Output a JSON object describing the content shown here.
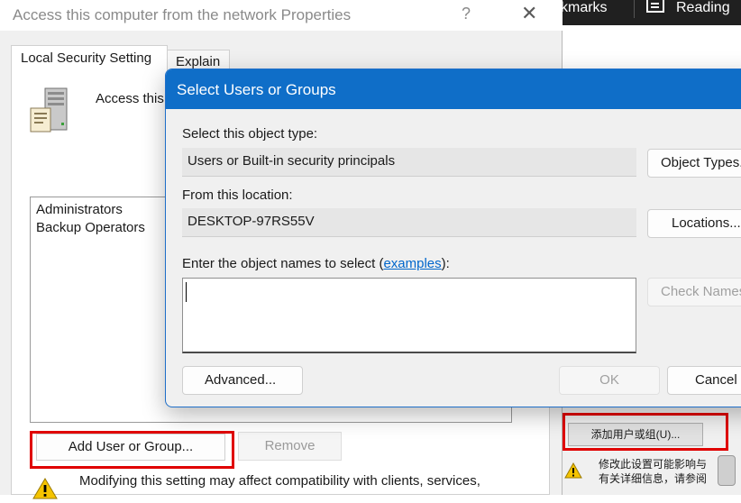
{
  "background": {
    "browser_toolbar": {
      "bookmarks_fragment": "kmarks",
      "reading_fragment": "Reading"
    },
    "chinese_dialog": {
      "add_button_label": "添加用户或组(U)...",
      "warning_line_1": "修改此设置可能影响与",
      "warning_line_2": "有关详细信息，请参阅"
    }
  },
  "properties_window": {
    "title": "Access this computer from the network Properties",
    "help_glyph": "?",
    "close_glyph": "✕",
    "tabs": [
      {
        "label": "Local Security Setting",
        "active": true
      },
      {
        "label": "Explain",
        "active": false
      }
    ],
    "policy_heading": "Access this",
    "members": [
      "Administrators",
      "Backup Operators"
    ],
    "add_button_label": "Add User or Group...",
    "remove_button_label": "Remove",
    "warning_text": "Modifying this setting may affect compatibility with clients, services,"
  },
  "select_dialog": {
    "title": "Select Users or Groups",
    "object_type_label": "Select this object type:",
    "object_type_value": "Users or Built-in security principals",
    "object_types_button": "Object Types...",
    "location_label": "From this location:",
    "location_value": "DESKTOP-97RS55V",
    "locations_button": "Locations...",
    "names_label_prefix": "Enter the object names to select (",
    "names_label_link": "examples",
    "names_label_suffix": "):",
    "names_input_value": "",
    "check_names_button": "Check Names",
    "advanced_button": "Advanced...",
    "ok_button": "OK",
    "cancel_button": "Cancel"
  },
  "colors": {
    "dialog_titlebar": "#0f6ec8",
    "highlight_frame": "#e00000",
    "link": "#0066cc",
    "window_bg": "#f0f0f0"
  }
}
